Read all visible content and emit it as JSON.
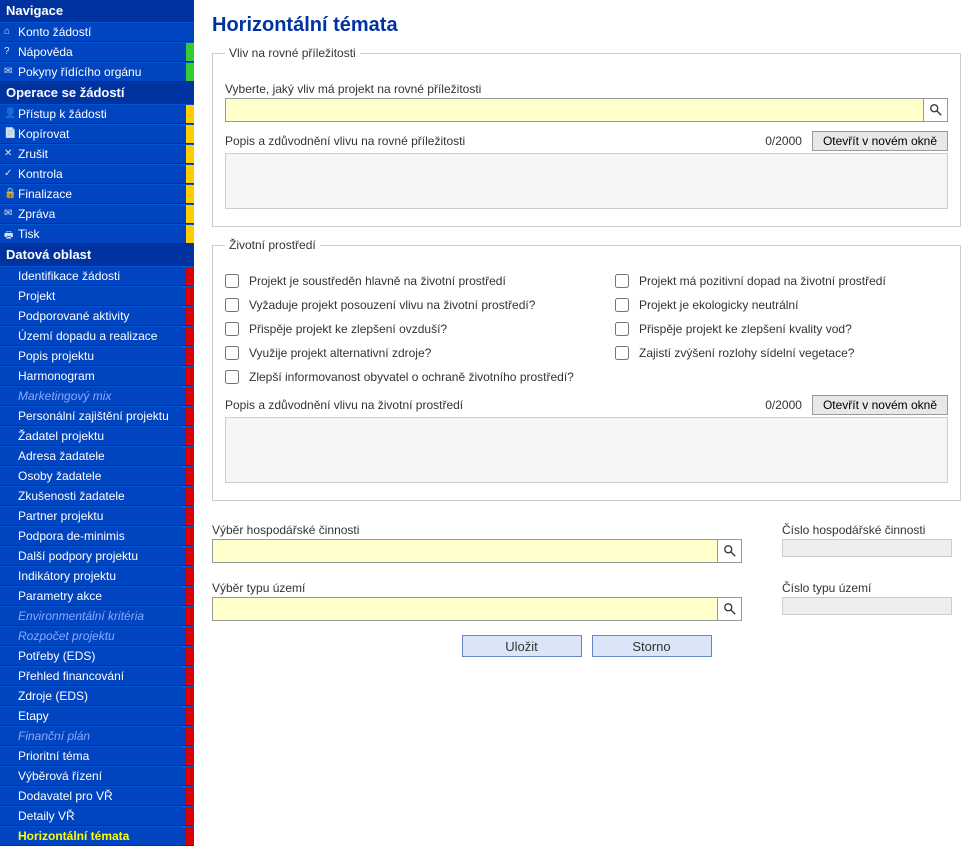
{
  "sidebar": {
    "sections": [
      {
        "title": "Navigace",
        "items": [
          {
            "label": "Konto žádostí",
            "glyph": "⌂",
            "stripe": null
          },
          {
            "label": "Nápověda",
            "glyph": "?",
            "stripe": "green"
          },
          {
            "label": "Pokyny řídícího orgánu",
            "glyph": "✉",
            "stripe": "green"
          }
        ]
      },
      {
        "title": "Operace se žádostí",
        "items": [
          {
            "label": "Přístup k žádosti",
            "glyph": "👤",
            "stripe": "yellow"
          },
          {
            "label": "Kopírovat",
            "glyph": "📄",
            "stripe": "yellow"
          },
          {
            "label": "Zrušit",
            "glyph": "✕",
            "stripe": "yellow"
          },
          {
            "label": "Kontrola",
            "glyph": "✓",
            "stripe": "yellow"
          },
          {
            "label": "Finalizace",
            "glyph": "🔒",
            "stripe": "yellow"
          },
          {
            "label": "Zpráva",
            "glyph": "✉",
            "stripe": "yellow"
          },
          {
            "label": "Tisk",
            "glyph": "🖶",
            "stripe": "yellow"
          }
        ]
      },
      {
        "title": "Datová oblast",
        "items": [
          {
            "label": "Identifikace žádosti",
            "stripe": "red"
          },
          {
            "label": "Projekt",
            "stripe": "red"
          },
          {
            "label": "Podporované aktivity",
            "stripe": "red"
          },
          {
            "label": "Území dopadu a realizace",
            "stripe": "red"
          },
          {
            "label": "Popis projektu",
            "stripe": "red"
          },
          {
            "label": "Harmonogram",
            "stripe": "red"
          },
          {
            "label": "Marketingový mix",
            "stripe": "red",
            "dim": true
          },
          {
            "label": "Personální zajištění projektu",
            "stripe": "red"
          },
          {
            "label": "Žadatel projektu",
            "stripe": "red"
          },
          {
            "label": "Adresa žadatele",
            "stripe": "red"
          },
          {
            "label": "Osoby žadatele",
            "stripe": "red"
          },
          {
            "label": "Zkušenosti žadatele",
            "stripe": "red"
          },
          {
            "label": "Partner projektu",
            "stripe": "red"
          },
          {
            "label": "Podpora de-minimis",
            "stripe": "red"
          },
          {
            "label": "Další podpory projektu",
            "stripe": "red"
          },
          {
            "label": "Indikátory projektu",
            "stripe": "red"
          },
          {
            "label": "Parametry akce",
            "stripe": "red"
          },
          {
            "label": "Environmentální kritéria",
            "stripe": "red",
            "dim": true
          },
          {
            "label": "Rozpočet projektu",
            "stripe": "red",
            "dim": true
          },
          {
            "label": "Potřeby (EDS)",
            "stripe": "red"
          },
          {
            "label": "Přehled financování",
            "stripe": "red"
          },
          {
            "label": "Zdroje (EDS)",
            "stripe": "red"
          },
          {
            "label": "Etapy",
            "stripe": "red"
          },
          {
            "label": "Finanční plán",
            "stripe": "red",
            "dim": true
          },
          {
            "label": "Prioritní téma",
            "stripe": "red"
          },
          {
            "label": "Výběrová řízení",
            "stripe": "red"
          },
          {
            "label": "Dodavatel pro VŘ",
            "stripe": "red"
          },
          {
            "label": "Detaily VŘ",
            "stripe": "red"
          },
          {
            "label": "Horizontální témata",
            "stripe": "red",
            "active": true
          }
        ]
      }
    ]
  },
  "page": {
    "title": "Horizontální témata",
    "section1": {
      "legend": "Vliv na rovné příležitosti",
      "selectLabel": "Vyberte, jaký vliv má projekt na rovné příležitosti",
      "descLabel": "Popis a zdůvodnění vlivu na rovné příležitosti",
      "counter": "0/2000",
      "openBtn": "Otevřít v novém okně"
    },
    "section2": {
      "legend": "Životní prostředí",
      "checksLeft": [
        "Projekt je soustředěn hlavně na životní prostředí",
        "Vyžaduje projekt posouzení vlivu na životní prostředí?",
        "Přispěje projekt ke zlepšení ovzduší?",
        "Využije projekt alternativní zdroje?",
        "Zlepší informovanost obyvatel o ochraně životního prostředí?"
      ],
      "checksRight": [
        "Projekt má pozitivní dopad na životní prostředí",
        "Projekt je ekologicky neutrální",
        "Přispěje projekt ke zlepšení kvality vod?",
        "Zajistí zvýšení rozlohy sídelní vegetace?"
      ],
      "descLabel": "Popis a zdůvodnění vlivu na životní prostředí",
      "counter": "0/2000",
      "openBtn": "Otevřít v novém okně"
    },
    "bottom": {
      "activityLabel": "Výběr hospodářské činnosti",
      "activityNumLabel": "Číslo hospodářské činnosti",
      "territoryLabel": "Výběr typu území",
      "territoryNumLabel": "Číslo typu území"
    },
    "buttons": {
      "save": "Uložit",
      "cancel": "Storno"
    }
  }
}
